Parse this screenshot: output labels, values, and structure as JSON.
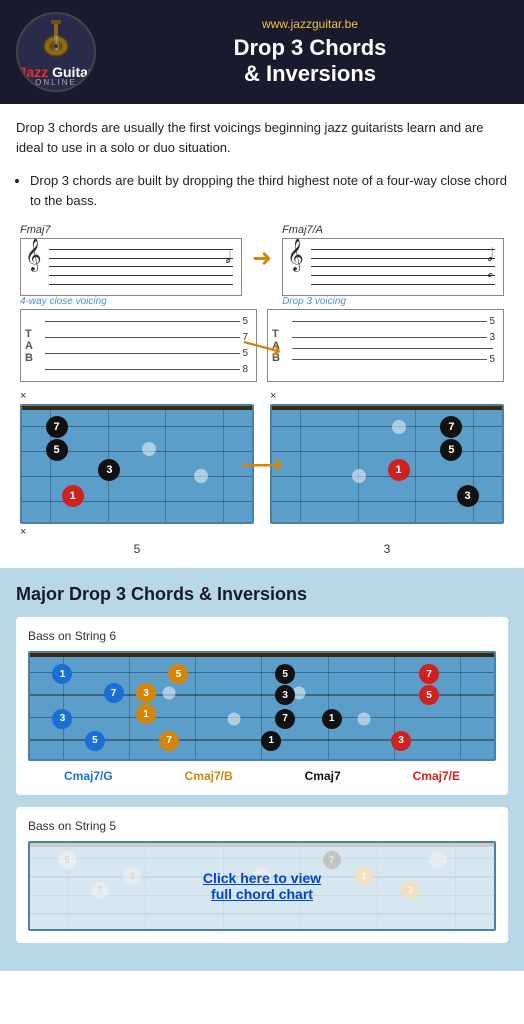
{
  "header": {
    "url": "www.jazzguitar.be",
    "title_line1": "Drop 3 Chords",
    "title_line2": "& Inversions",
    "logo_jazz": "Jazz",
    "logo_guitar": "Guitar",
    "logo_online": "ONLINE"
  },
  "intro": {
    "text": "Drop 3 chords are usually the first voicings beginning jazz guitarists learn and are ideal to use in a solo or duo situation.",
    "bullet": "Drop 3 chords are built by dropping the third highest note of a four-way close chord to the bass."
  },
  "staff_section": {
    "chord1_label": "Fmaj7",
    "chord2_label": "Fmaj7/A",
    "caption1": "4-way close voicing",
    "caption2": "Drop 3 voicing"
  },
  "fretboard_labels": {
    "label1": "5",
    "label2": "3"
  },
  "major_section": {
    "title": "Major Drop 3 Chords & Inversions",
    "bass_string6": "Bass on String 6",
    "bass_string5": "Bass on String 5",
    "chord_names": [
      "Cmaj7/G",
      "Cmaj7/B",
      "Cmaj7",
      "Cmaj7/E"
    ],
    "click_text1": "Click here to view",
    "click_text2": "full chord chart"
  }
}
